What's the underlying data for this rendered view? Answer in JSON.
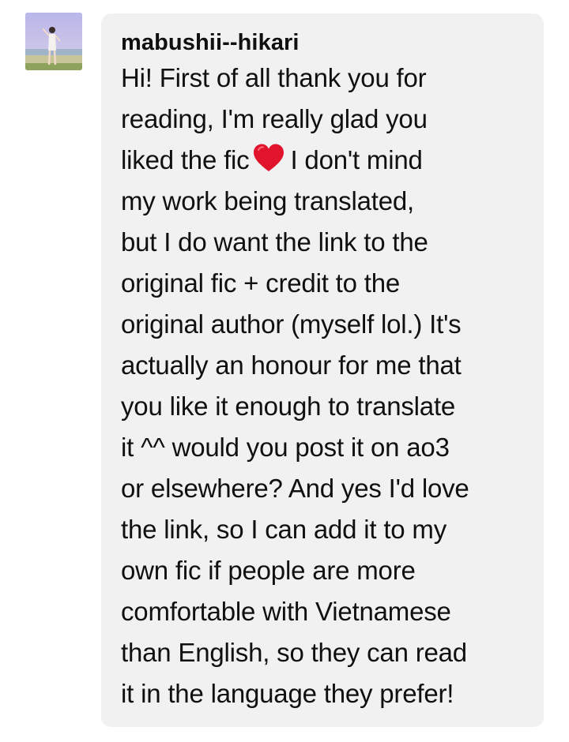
{
  "post": {
    "avatar_icon": "user-avatar-photo",
    "username": "mabushii--hikari",
    "message_lines": {
      "l1": "Hi! First of all thank you for",
      "l2": "reading, I'm really glad you",
      "l3a": "liked the fic",
      "l3_emoji": "red-heart-icon",
      "l3b": "I don't mind",
      "l4": "my work being translated,",
      "l5": "but I do want the link to the",
      "l6": "original fic + credit to the",
      "l7": "original author (myself lol.) It's",
      "l8": "actually an honour for me that",
      "l9": "you like it enough to translate",
      "l10": "it ^^ would you post it on ao3",
      "l11": "or elsewhere? And yes I'd love",
      "l12": "the link, so I can add it to my",
      "l13": "own fic if people are more",
      "l14": "comfortable with Vietnamese",
      "l15": "than English, so they can read",
      "l16": "it in the language they prefer!"
    }
  },
  "colors": {
    "bubble_background": "#f1f1f1",
    "text": "#101010",
    "heart": "#e0142a"
  }
}
